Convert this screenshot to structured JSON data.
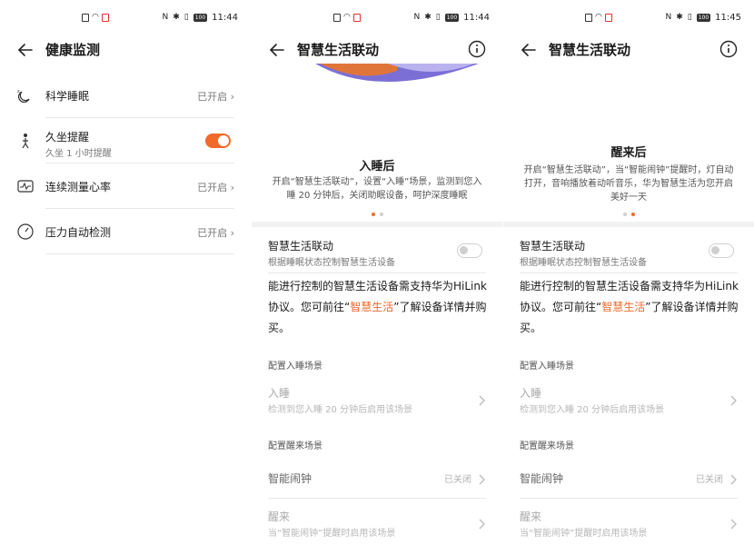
{
  "panel1": {
    "status_time": "11:44",
    "battery": "100",
    "title": "健康监测",
    "rows": [
      {
        "label": "科学睡眠",
        "value": "已开启"
      },
      {
        "label": "久坐提醒",
        "sub": "久坐 1 小时提醒"
      },
      {
        "label": "连续测量心率",
        "value": "已开启"
      },
      {
        "label": "压力自动检测",
        "value": "已开启"
      }
    ]
  },
  "panel2": {
    "status_time": "11:44",
    "battery": "100",
    "title": "智慧生活联动",
    "caption_title": "入睡后",
    "caption_desc": "开启“智慧生活联动”，设置“入睡”场景，监测到您入睡 20 分钟后，关闭助眠设备，呵护深度睡眠",
    "switch_title": "智慧生活联动",
    "switch_sub": "根据睡眠状态控制智慧生活设备",
    "para_a": "能进行控制的智慧生活设备需支持华为HiLink 协议。您可前往“",
    "para_link": "智慧生活",
    "para_b": "”了解设备详情并购买。",
    "sleep_group": "配置入睡场景",
    "sleep_item": "入睡",
    "sleep_item_sub": "检测到您入睡 20 分钟后启用该场景",
    "wake_group": "配置醒来场景",
    "alarm_item": "智能闹钟",
    "alarm_value": "已关闭",
    "wake_item": "醒来",
    "wake_item_sub": "当“智能闹钟”提醒时启用该场景"
  },
  "panel3": {
    "status_time": "11:45",
    "battery": "100",
    "title": "智慧生活联动",
    "caption_title": "醒来后",
    "caption_desc": "开启“智慧生活联动”，当“智能闹钟”提醒时，灯自动打开，音响播放着动听音乐，华为智慧生活为您开启美好一天",
    "switch_title": "智慧生活联动",
    "switch_sub": "根据睡眠状态控制智慧生活设备",
    "para_a": "能进行控制的智慧生活设备需支持华为HiLink 协议。您可前往“",
    "para_link": "智慧生活",
    "para_b": "”了解设备详情并购买。",
    "sleep_group": "配置入睡场景",
    "sleep_item": "入睡",
    "sleep_item_sub": "检测到您入睡 20 分钟后启用该场景",
    "wake_group": "配置醒来场景",
    "alarm_item": "智能闹钟",
    "alarm_value": "已关闭",
    "wake_item": "醒来",
    "wake_item_sub": "当“智能闹钟”提醒时启用该场景"
  },
  "colors": {
    "accent": "#f06a2a",
    "illustration": "#7b6fd6"
  },
  "carousel": {
    "panel2_active_dot": 1,
    "panel3_active_dot": 2,
    "dots_total": 2
  },
  "toggles": {
    "sedentary_reminder": true,
    "smart_life_panel2": false,
    "smart_life_panel3": false
  }
}
